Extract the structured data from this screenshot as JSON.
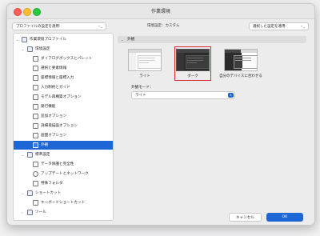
{
  "window": {
    "title": "作業環境"
  },
  "toolbar": {
    "profile_button": "プロファイルの設定を適用:",
    "profile_label": "環境設定：カスタム",
    "selected_apply_button": "選択した設定を適用:"
  },
  "sidebar": {
    "items": [
      {
        "label": "作業環境プロファイル",
        "icon": "profile-folder-icon",
        "chevron": "⌄"
      },
      {
        "label": "環境設定",
        "icon": "settings-folder-icon",
        "chevron": "⌄"
      },
      {
        "label": "ダイアログボックスとパレット",
        "icon": "doc-icon"
      },
      {
        "label": "選択と要素情報",
        "icon": "doc-icon"
      },
      {
        "label": "座標情報と座標入力",
        "icon": "doc-icon"
      },
      {
        "label": "入力制約とガイド",
        "icon": "doc-icon"
      },
      {
        "label": "モデル再構築オプション",
        "icon": "doc-icon"
      },
      {
        "label": "発行機能",
        "icon": "doc-icon"
      },
      {
        "label": "追加オプション",
        "icon": "doc-icon"
      },
      {
        "label": "詳細再描画オプション",
        "icon": "doc-icon"
      },
      {
        "label": "画面オプション",
        "icon": "doc-icon"
      },
      {
        "label": "外観",
        "icon": "doc-icon",
        "selected": true
      },
      {
        "label": "標準設定",
        "icon": "standard-folder-icon",
        "chevron": "⌄"
      },
      {
        "label": "データ保護と完全性",
        "icon": "doc-icon"
      },
      {
        "label": "アップデートとネットワーク",
        "icon": "globe-icon"
      },
      {
        "label": "特殊フォルダ",
        "icon": "doc-icon"
      },
      {
        "label": "ショートカット",
        "icon": "shortcut-folder-icon",
        "chevron": "⌄"
      },
      {
        "label": "キーボードショートカット",
        "icon": "keyboard-icon"
      },
      {
        "label": "ツール",
        "icon": "tools-folder-icon",
        "chevron": "›"
      }
    ]
  },
  "content": {
    "section_title": "外観",
    "themes": [
      {
        "label": "ライト"
      },
      {
        "label": "ダーク",
        "selected": true
      },
      {
        "label": "自分のデバイスに合わせる"
      }
    ],
    "mode_label": "外観モード：",
    "mode_value": "ライト"
  },
  "footer": {
    "cancel_label": "キャンセル",
    "ok_label": "OK"
  },
  "colors": {
    "accent": "#1d66d6",
    "selection_highlight": "#d6282d"
  }
}
